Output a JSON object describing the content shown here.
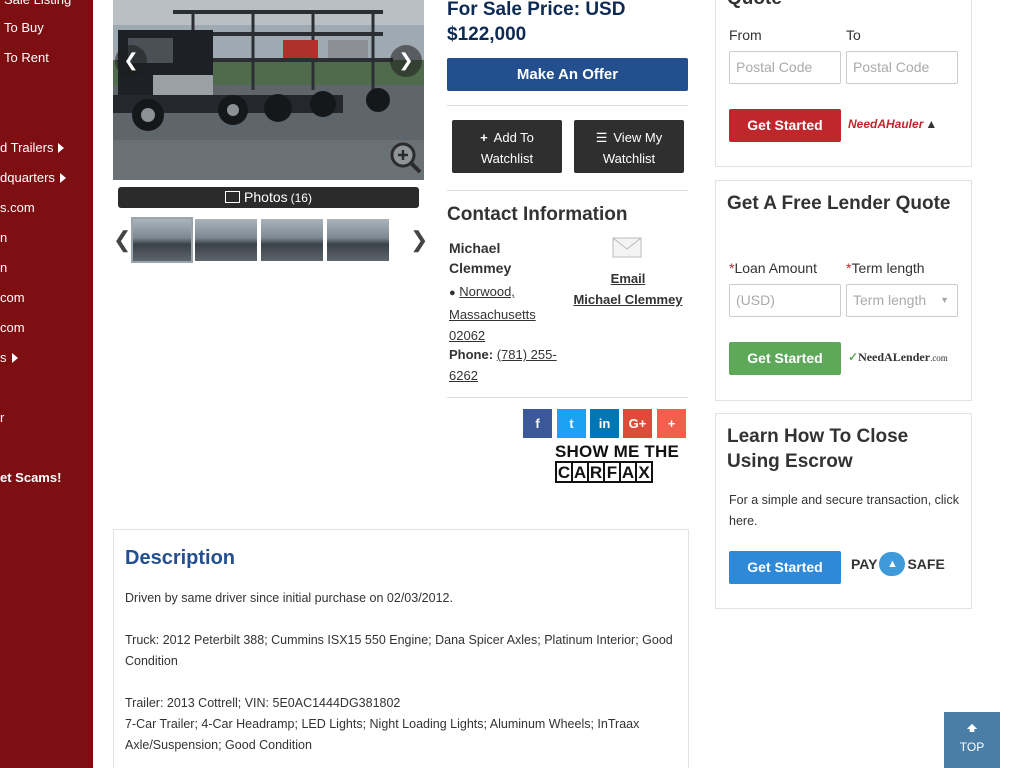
{
  "sidebar": {
    "items": [
      {
        "label": "Sale Listing",
        "arrow": false,
        "bold": false
      },
      {
        "label": "To Buy",
        "arrow": false,
        "bold": false
      },
      {
        "label": "To Rent",
        "arrow": false,
        "bold": false
      },
      {
        "label": "d Trailers",
        "arrow": true,
        "bold": false
      },
      {
        "label": "dquarters",
        "arrow": true,
        "bold": false
      },
      {
        "label": "s.com",
        "arrow": false,
        "bold": false
      },
      {
        "label": "n",
        "arrow": false,
        "bold": false
      },
      {
        "label": "n",
        "arrow": false,
        "bold": false
      },
      {
        "label": "com",
        "arrow": false,
        "bold": false
      },
      {
        "label": "com",
        "arrow": false,
        "bold": false
      },
      {
        "label": "s",
        "arrow": true,
        "bold": false
      },
      {
        "label": "r",
        "arrow": false,
        "bold": false
      },
      {
        "label": "et Scams!",
        "arrow": false,
        "bold": true
      }
    ]
  },
  "gallery": {
    "photos_label": "Photos",
    "photos_count": "(16)",
    "prev_icon": "chevron-left-icon",
    "next_icon": "chevron-right-icon",
    "zoom_icon": "zoom-in-icon"
  },
  "listing": {
    "price_label": "For Sale Price: USD",
    "price_value": "$122,000",
    "offer_label": "Make An Offer",
    "add_watchlist": {
      "line1": "Add To",
      "line2": "Watchlist"
    },
    "view_watchlist": {
      "line1": "View My",
      "line2": "Watchlist"
    }
  },
  "contact": {
    "title": "Contact Information",
    "name": "Michael Clemmey",
    "address_line1": "Norwood,",
    "address_line2": "Massachusetts",
    "address_line3": "02062",
    "phone_label": "Phone:",
    "phone": "(781) 255-6262",
    "email_label": "Email",
    "email_name": "Michael Clemmey"
  },
  "social": [
    {
      "icon": "f",
      "name": "facebook",
      "color": "#3b5998"
    },
    {
      "icon": "t",
      "name": "twitter",
      "color": "#1da1f2"
    },
    {
      "icon": "in",
      "name": "linkedin",
      "color": "#0077b5"
    },
    {
      "icon": "G+",
      "name": "google-plus",
      "color": "#dd4b39"
    },
    {
      "icon": "+",
      "name": "share-more",
      "color": "#f0604d"
    }
  ],
  "carfax": {
    "top": "SHOW ME THE",
    "letters": [
      "C",
      "A",
      "R",
      "F",
      "A",
      "X"
    ]
  },
  "description": {
    "title": "Description",
    "paragraphs": [
      "Driven by same driver since initial purchase on 02/03/2012.",
      "Truck: 2012 Peterbilt 388; Cummins ISX15 550 Engine; Dana Spicer Axles; Platinum Interior; Good Condition",
      "Trailer: 2013 Cottrell; VIN: 5E0AC1444DG381802",
      "7-Car Trailer; 4-Car Headramp; LED Lights; Night Loading Lights; Aluminum Wheels; InTraax Axle/Suspension; Good Condition"
    ]
  },
  "hauler": {
    "title_partial": "Quote",
    "from_label": "From",
    "to_label": "To",
    "from_placeholder": "Postal Code",
    "to_placeholder": "Postal Code",
    "button": "Get Started",
    "logo_text": "NeedAHauler"
  },
  "lender": {
    "title": "Get A Free Lender Quote",
    "loan_label": "Loan Amount",
    "term_label": "Term length",
    "loan_placeholder": "(USD)",
    "term_placeholder": "Term length",
    "button": "Get Started",
    "logo_text": "NeedALender",
    "logo_suffix": ".com"
  },
  "escrow": {
    "title": "Learn How To Close Using Escrow",
    "text": "For a simple and secure transaction, click here.",
    "button": "Get Started",
    "logo_left": "PAY",
    "logo_right": "SAFE"
  },
  "scroll_top": {
    "label": "TOP"
  },
  "colors": {
    "sidebar": "#7d0e12",
    "brand_blue": "#234f8f",
    "hauler_btn": "#c0272d",
    "lender_btn": "#5ea85a",
    "escrow_btn": "#2e8ad8"
  }
}
